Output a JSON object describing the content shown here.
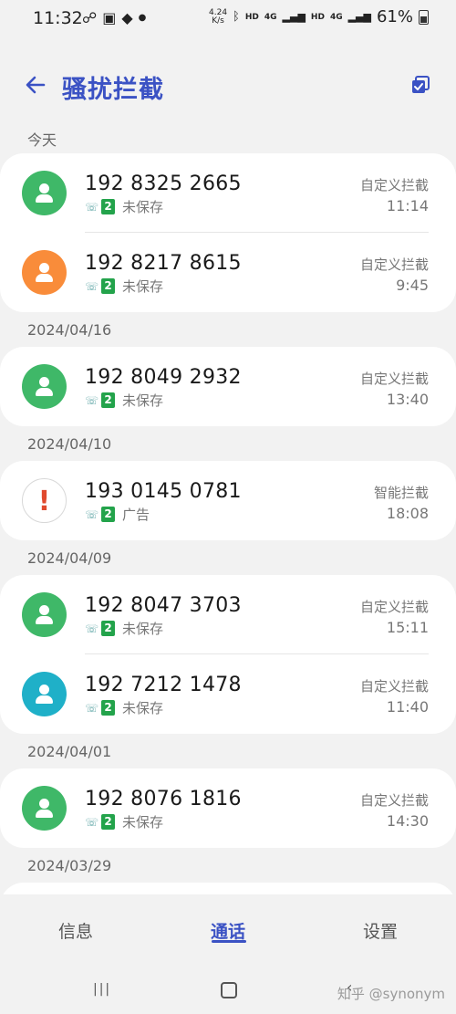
{
  "status_bar": {
    "time": "11:32",
    "speed_top": "4.24",
    "speed_bottom": "K/s",
    "hd1": "HD",
    "net1": "4G",
    "hd2": "HD",
    "net2": "4G",
    "battery": "61%"
  },
  "header": {
    "title": "骚扰拦截"
  },
  "sections": [
    {
      "date": "今天",
      "calls": [
        {
          "number": "192 8325 2665",
          "status": "未保存",
          "sim": "2",
          "block_type": "自定义拦截",
          "time": "11:14",
          "avatar_color": "#3fb868"
        },
        {
          "number": "192 8217 8615",
          "status": "未保存",
          "sim": "2",
          "block_type": "自定义拦截",
          "time": "9:45",
          "avatar_color": "#f98c3a"
        }
      ]
    },
    {
      "date": "2024/04/16",
      "calls": [
        {
          "number": "192 8049 2932",
          "status": "未保存",
          "sim": "2",
          "block_type": "自定义拦截",
          "time": "13:40",
          "avatar_color": "#3fb868"
        }
      ]
    },
    {
      "date": "2024/04/10",
      "calls": [
        {
          "number": "193 0145 0781",
          "status": "广告",
          "sim": "2",
          "block_type": "智能拦截",
          "time": "18:08",
          "avatar_color": "warning"
        }
      ]
    },
    {
      "date": "2024/04/09",
      "calls": [
        {
          "number": "192 8047 3703",
          "status": "未保存",
          "sim": "2",
          "block_type": "自定义拦截",
          "time": "15:11",
          "avatar_color": "#3fb868"
        },
        {
          "number": "192 7212 1478",
          "status": "未保存",
          "sim": "2",
          "block_type": "自定义拦截",
          "time": "11:40",
          "avatar_color": "#1fb0c8"
        }
      ]
    },
    {
      "date": "2024/04/01",
      "calls": [
        {
          "number": "192 8076 1816",
          "status": "未保存",
          "sim": "2",
          "block_type": "自定义拦截",
          "time": "14:30",
          "avatar_color": "#3fb868"
        }
      ]
    },
    {
      "date": "2024/03/29",
      "calls": []
    }
  ],
  "bottom_nav": {
    "tabs": [
      "信息",
      "通话",
      "设置"
    ],
    "active": "通话"
  },
  "watermark": "知乎 @synonym",
  "colors": {
    "accent": "#3b52c4",
    "sim_badge": "#23a34b"
  }
}
